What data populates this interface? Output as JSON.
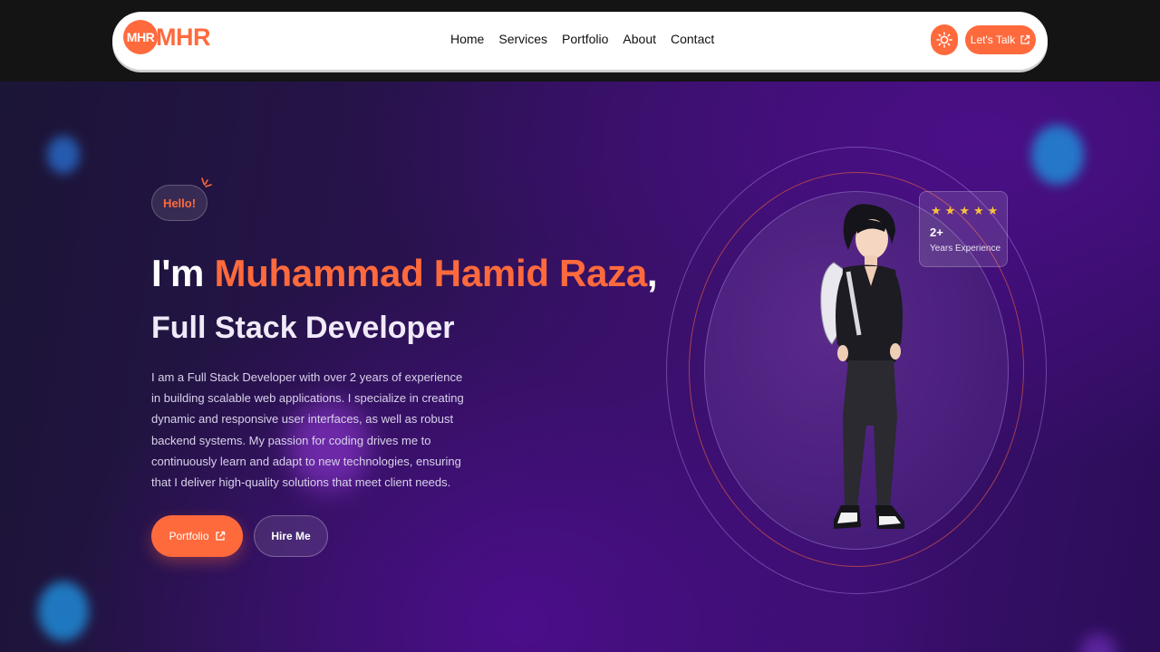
{
  "brand": {
    "badge": "MHR",
    "name": "MHR"
  },
  "nav": {
    "links": [
      "Home",
      "Services",
      "Portfolio",
      "About",
      "Contact"
    ],
    "cta_label": "Let's Talk",
    "cta_icon": "external-link-icon",
    "theme_icon": "sun-icon"
  },
  "hero": {
    "greeting": "Hello!",
    "headline_prefix": "I'm ",
    "name": "Muhammad Hamid Raza",
    "headline_suffix": ",",
    "role": "Full Stack Developer",
    "description": "I am a Full Stack Developer with over 2 years of experience in building scalable web applications. I specialize in creating dynamic and responsive user interfaces, as well as robust backend systems. My passion for coding drives me to continuously learn and adapt to new technologies, ensuring that I deliver high-quality solutions that meet client needs.",
    "primary_button": "Portfolio",
    "primary_button_icon": "external-link-icon",
    "secondary_button": "Hire Me"
  },
  "experience_card": {
    "rating": 5,
    "value": "2+",
    "label": "Years Experience"
  },
  "colors": {
    "accent": "#ff6a3d",
    "star": "#f7c23b",
    "background_purple": "#3a0f6d",
    "topbar": "#141414"
  }
}
